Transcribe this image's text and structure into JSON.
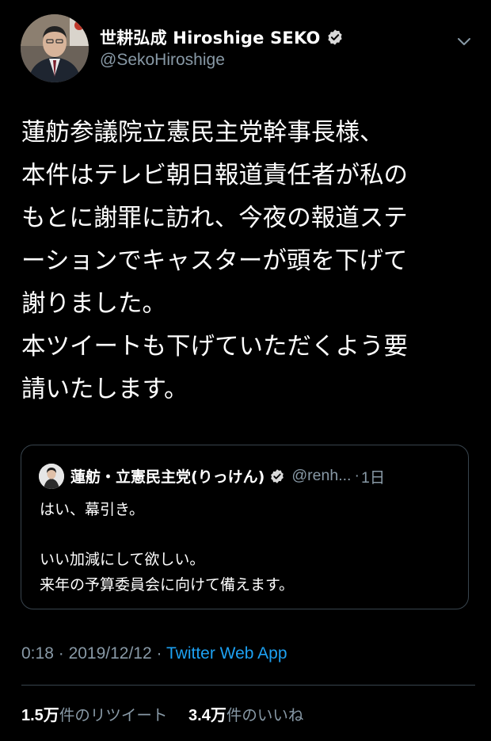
{
  "author": {
    "display_name": "世耕弘成 Hiroshige SEKO",
    "handle": "@SekoHiroshige",
    "verified": true
  },
  "tweet": {
    "lines": [
      "蓮舫参議院立憲民主党幹事長様、",
      "本件はテレビ朝日報道責任者が私の",
      "もとに謝罪に訪れ、今夜の報道ステ",
      "ーションでキャスターが頭を下げて",
      "謝りました。",
      "本ツイートも下げていただくよう要",
      "請いたします。"
    ]
  },
  "quoted_tweet": {
    "display_name": "蓮舫・立憲民主党(りっけん)",
    "handle": "@renh...",
    "separator": "·",
    "time": "1日",
    "verified": true,
    "lines": [
      "はい、幕引き。",
      "",
      "いい加減にして欲しい。",
      "来年の予算委員会に向けて備えます。"
    ]
  },
  "meta": {
    "time": "0:18",
    "sep1": "·",
    "date": "2019/12/12",
    "sep2": "·",
    "source": "Twitter Web App"
  },
  "stats": {
    "retweets_count": "1.5万",
    "retweets_label": "件のリツイート",
    "likes_count": "3.4万",
    "likes_label": "件のいいね"
  },
  "colors": {
    "background": "#000000",
    "primary_text": "#ffffff",
    "secondary_text": "#8899a6",
    "link": "#1da1f2",
    "border": "#38444d"
  },
  "icons": {
    "verified": "verified-badge-icon",
    "caret": "chevron-down-icon"
  }
}
